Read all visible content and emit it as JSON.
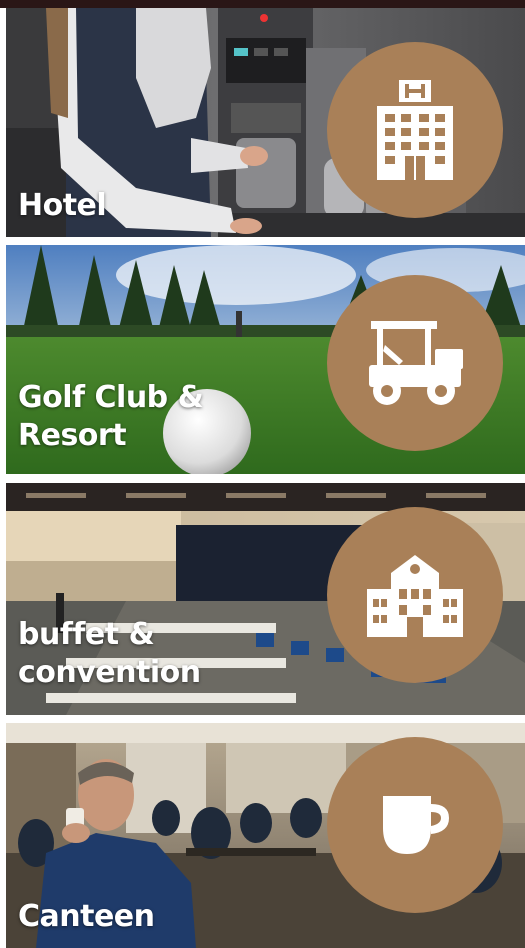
{
  "theme": {
    "accent": "#a98058",
    "topbar": "#2a1616"
  },
  "tiles": [
    {
      "label": "Hotel",
      "icon": "hotel-building-icon"
    },
    {
      "label": "Golf Club & Resort",
      "label_line1": "Golf Club &",
      "label_line2": "Resort",
      "icon": "golf-cart-icon"
    },
    {
      "label": "buffet & convention",
      "label_line1": "buffet &",
      "label_line2": "convention",
      "icon": "convention-building-icon"
    },
    {
      "label": "Canteen",
      "icon": "coffee-cup-icon"
    }
  ]
}
